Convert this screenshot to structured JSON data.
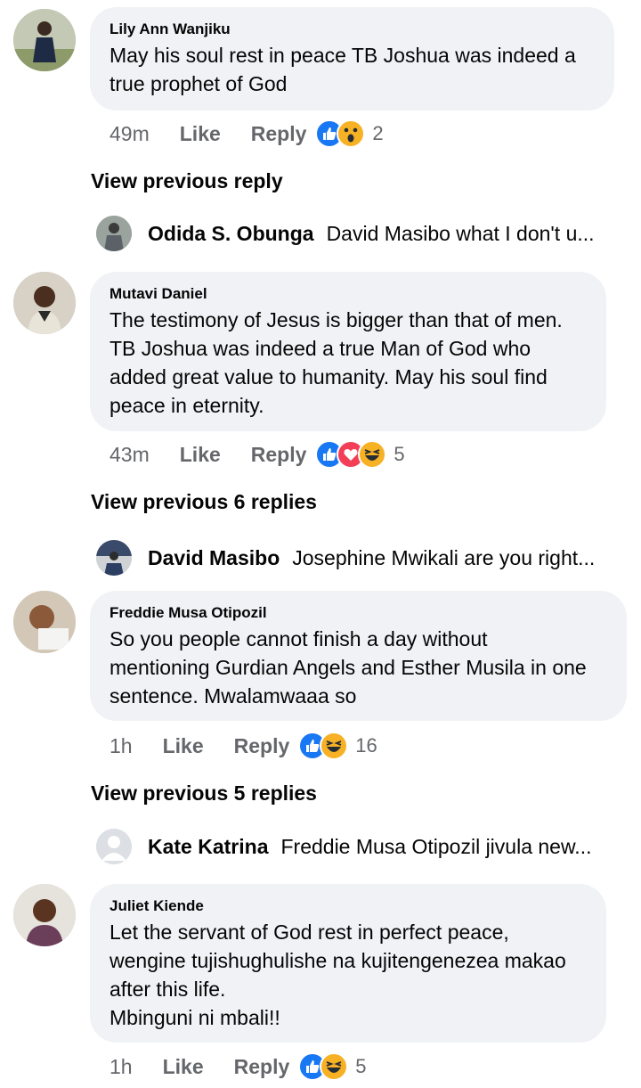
{
  "comments": [
    {
      "author": "Lily Ann Wanjiku",
      "text": "May his soul rest in peace TB Joshua was indeed a\ntrue prophet of God",
      "time": "49m",
      "like_label": "Like",
      "reply_label": "Reply",
      "reactions": [
        "like-icon",
        "wow-icon"
      ],
      "reaction_count": "2",
      "view_previous": "View previous reply",
      "latest_reply": {
        "author": "Odida S. Obunga",
        "text": "David Masibo what I don't u..."
      }
    },
    {
      "author": "Mutavi Daniel",
      "text": "The testimony of Jesus is bigger than that of men.\nTB Joshua was indeed a true Man of God who\nadded great value to humanity. May his soul find\npeace in eternity.",
      "time": "43m",
      "like_label": "Like",
      "reply_label": "Reply",
      "reactions": [
        "like-icon",
        "love-icon",
        "haha-icon"
      ],
      "reaction_count": "5",
      "view_previous": "View previous 6 replies",
      "latest_reply": {
        "author": "David Masibo",
        "text": "Josephine Mwikali are you right..."
      }
    },
    {
      "author": "Freddie Musa Otipozil",
      "text": "So you people cannot finish a day without\nmentioning Gurdian Angels and Esther Musila in one\nsentence. Mwalamwaaa so",
      "time": "1h",
      "like_label": "Like",
      "reply_label": "Reply",
      "reactions": [
        "like-icon",
        "haha-icon"
      ],
      "reaction_count": "16",
      "view_previous": "View previous 5 replies",
      "latest_reply": {
        "author": "Kate Katrina",
        "text": "Freddie Musa Otipozil jivula new..."
      }
    },
    {
      "author": "Juliet Kiende",
      "text": "Let the servant of God rest in perfect peace,\nwengine tujishughulishe na kujitengenezea makao\nafter this life.\nMbinguni ni mbali!!",
      "time": "1h",
      "like_label": "Like",
      "reply_label": "Reply",
      "reactions": [
        "like-icon",
        "haha-icon"
      ],
      "reaction_count": "5"
    }
  ],
  "colors": {
    "bubble_bg": "#f0f2f5",
    "meta_text": "#65676b",
    "like_blue": "#1877f2",
    "love_red": "#f33e58",
    "reaction_yellow": "#f7b125"
  }
}
